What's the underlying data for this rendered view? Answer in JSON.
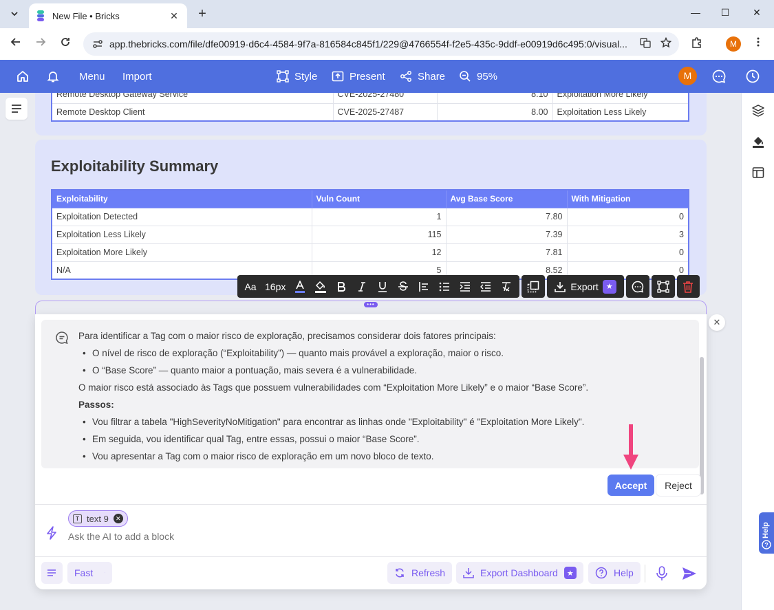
{
  "browser": {
    "tab_title": "New File • Bricks",
    "new_tab": "+",
    "tab_close": "✕",
    "url": "app.thebricks.com/file/dfe00919-d6c4-4584-9f7a-816584c845f1/229@4766554f-f2e5-435c-9ddf-e00919d6c495:0/visual...",
    "profile_initial": "M",
    "win_minimize": "—",
    "win_maximize": "☐",
    "win_close": "✕"
  },
  "toolbar": {
    "menu": "Menu",
    "import": "Import",
    "style": "Style",
    "present": "Present",
    "share": "Share",
    "zoom": "95%",
    "user_initial": "M"
  },
  "top_table": {
    "rows": [
      [
        "Remote Desktop Gateway Service",
        "CVE-2025-27480",
        "8.10",
        "Exploitation More Likely"
      ],
      [
        "Remote Desktop Client",
        "CVE-2025-27487",
        "8.00",
        "Exploitation Less Likely"
      ]
    ]
  },
  "summary": {
    "title": "Exploitability Summary",
    "headers": [
      "Exploitability",
      "Vuln Count",
      "Avg Base Score",
      "With Mitigation"
    ],
    "rows": [
      [
        "Exploitation Detected",
        "1",
        "7.80",
        "0"
      ],
      [
        "Exploitation Less Likely",
        "115",
        "7.39",
        "3"
      ],
      [
        "Exploitation More Likely",
        "12",
        "7.81",
        "0"
      ],
      [
        "N/A",
        "5",
        "8.52",
        "0"
      ]
    ]
  },
  "format_bar": {
    "font_icon": "Aa",
    "font_size": "16px",
    "export": "Export"
  },
  "ai": {
    "intro": "Para identificar a Tag com o maior risco de exploração, precisamos considerar dois fatores principais:",
    "bullet1": "O nível de risco de exploração (“Exploitability”) — quanto mais provável a exploração, maior o risco.",
    "bullet2": "O “Base Score” — quanto maior a pontuação, mais severa é a vulnerabilidade.",
    "conclusion": "O maior risco está associado às Tags que possuem vulnerabilidades com “Exploitation More Likely” e o maior “Base Score”.",
    "steps_title": "Passos:",
    "step1": "Vou filtrar a tabela \"HighSeverityNoMitigation\" para encontrar as linhas onde \"Exploitability\" é \"Exploitation More Likely\".",
    "step2": "Em seguida, vou identificar qual Tag, entre essas, possui o maior “Base Score”.",
    "step3": "Vou apresentar a Tag com o maior risco de exploração em um novo bloco de texto.",
    "accept": "Accept",
    "reject": "Reject",
    "chip_label": "text 9",
    "chip_icon": "T",
    "input_placeholder": "Ask the AI to add a block",
    "mode": "Fast",
    "refresh": "Refresh",
    "export_dashboard": "Export Dashboard",
    "help": "Help"
  },
  "help_tab": "Help",
  "colors": {
    "toolbar_blue": "#4f6fdf",
    "accent_purple": "#7a5cf0",
    "table_header": "#6b7ef7",
    "accept_blue": "#5b7af0",
    "arrow_pink": "#f0457f"
  }
}
